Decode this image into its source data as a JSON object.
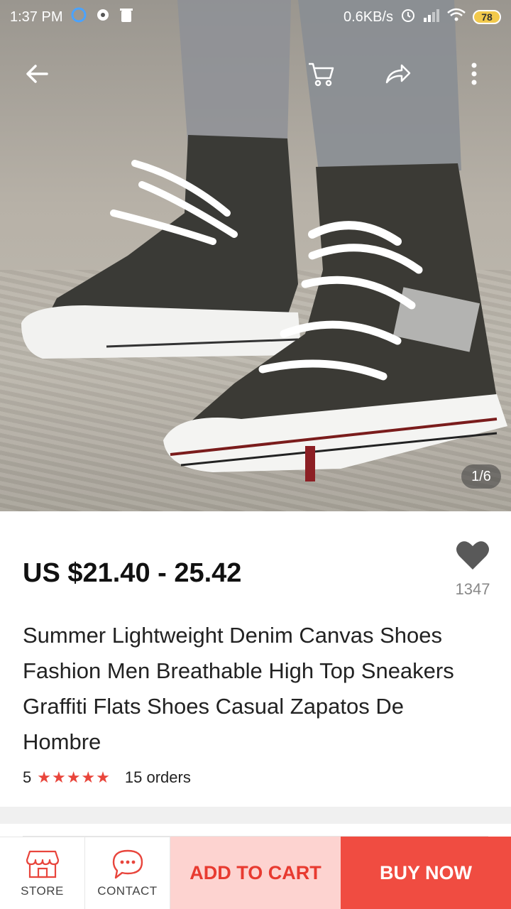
{
  "status_bar": {
    "time": "1:37 PM",
    "network_speed": "0.6KB/s",
    "battery": "78",
    "icons": [
      "notification-icon",
      "headset-icon",
      "trash-icon",
      "alarm-icon",
      "signal-icon",
      "wifi-icon",
      "battery-icon"
    ]
  },
  "top_bar": {
    "icons": [
      "back-arrow-icon",
      "cart-icon",
      "share-icon",
      "more-icon"
    ]
  },
  "gallery": {
    "image_alt": "product-photo",
    "pager": "1/6"
  },
  "product": {
    "price": "US $21.40 - 25.42",
    "wishlist_count": "1347",
    "title": "Summer Lightweight Denim Canvas Shoes Fashion Men Breathable High Top Sneakers Graffiti Flats Shoes Casual Zapatos De Hombre",
    "rating": "5",
    "stars": "★★★★★",
    "orders": "15 orders"
  },
  "bottom_bar": {
    "store_label": "STORE",
    "contact_label": "CONTACT",
    "add_to_cart": "ADD TO CART",
    "buy_now": "BUY NOW"
  },
  "colors": {
    "accent": "#f04c41",
    "accent_light": "#fdd3d0",
    "star": "#e9453b"
  }
}
